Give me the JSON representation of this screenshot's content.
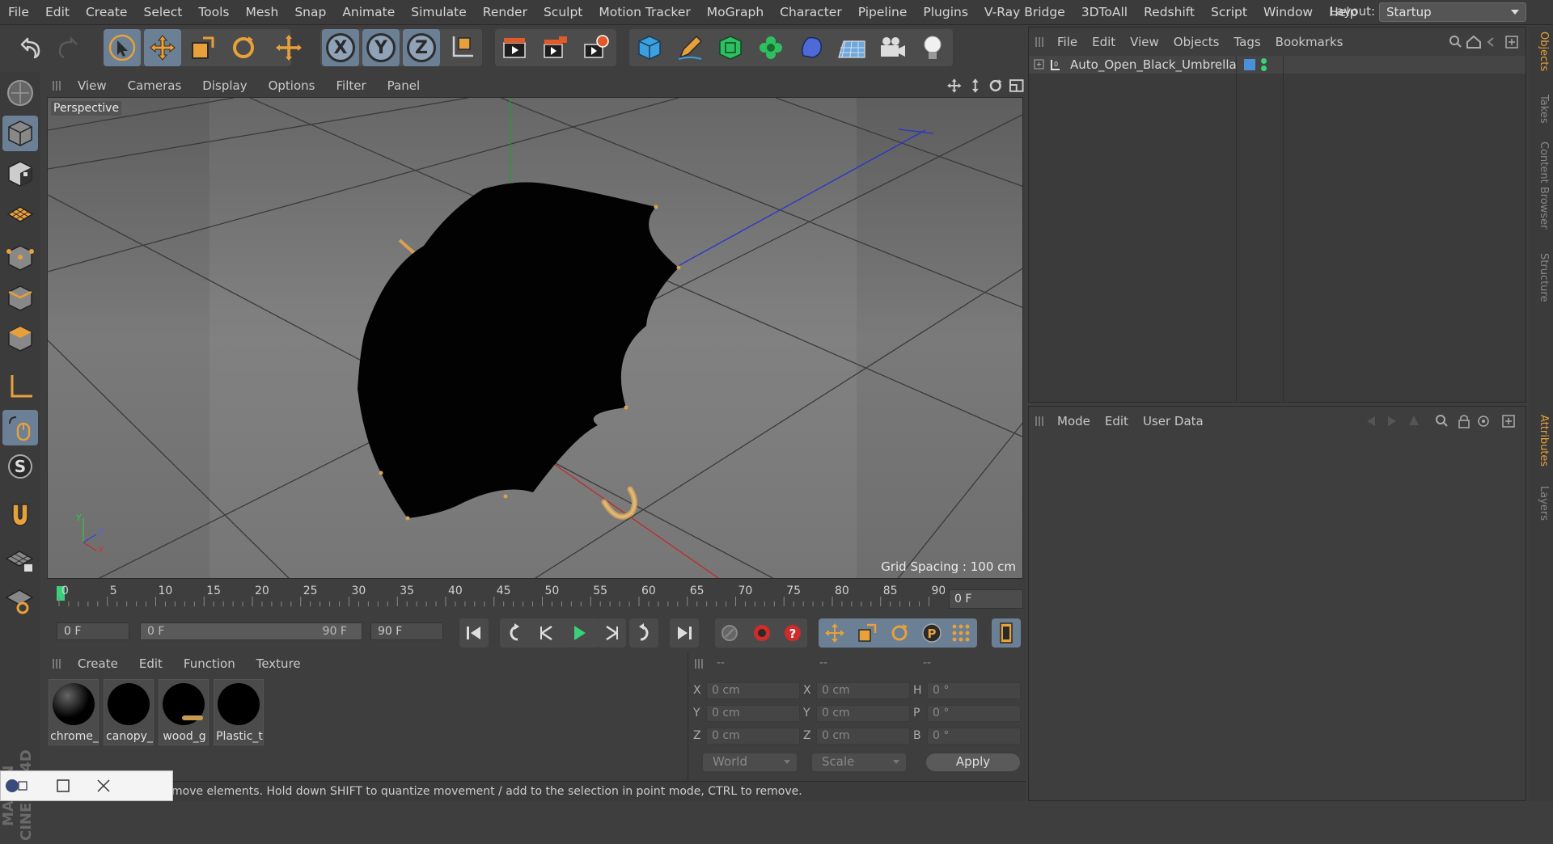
{
  "menubar": {
    "items": [
      "File",
      "Edit",
      "Create",
      "Select",
      "Tools",
      "Mesh",
      "Snap",
      "Animate",
      "Simulate",
      "Render",
      "Sculpt",
      "Motion Tracker",
      "MoGraph",
      "Character",
      "Pipeline",
      "Plugins",
      "V-Ray Bridge",
      "3DToAll",
      "Redshift",
      "Script",
      "Window",
      "Help"
    ],
    "layout_label": "Layout:",
    "layout_value": "Startup"
  },
  "viewport": {
    "menu": [
      "View",
      "Cameras",
      "Display",
      "Options",
      "Filter",
      "Panel"
    ],
    "label": "Perspective",
    "grid_spacing": "Grid Spacing : 100 cm",
    "axis_labels": {
      "y": "Y",
      "z": "Z",
      "x": "X"
    }
  },
  "timeline": {
    "ticks": [
      "0",
      "5",
      "10",
      "15",
      "20",
      "25",
      "30",
      "35",
      "40",
      "45",
      "50",
      "55",
      "60",
      "65",
      "70",
      "75",
      "80",
      "85",
      "90"
    ],
    "current_frame": "0 F",
    "start": "0 F",
    "range_start": "0 F",
    "range_end": "90 F",
    "end": "90 F"
  },
  "materials": {
    "menu": [
      "Create",
      "Edit",
      "Function",
      "Texture"
    ],
    "items": [
      "chrome_",
      "canopy_",
      "wood_g",
      "Plastic_t"
    ]
  },
  "coords": {
    "header": [
      "--",
      "--",
      "--"
    ],
    "rows": [
      {
        "a": "X",
        "av": "0 cm",
        "b": "X",
        "bv": "0 cm",
        "c": "H",
        "cv": "0 °"
      },
      {
        "a": "Y",
        "av": "0 cm",
        "b": "Y",
        "bv": "0 cm",
        "c": "P",
        "cv": "0 °"
      },
      {
        "a": "Z",
        "av": "0 cm",
        "b": "Z",
        "bv": "0 cm",
        "c": "B",
        "cv": "0 °"
      }
    ],
    "mode": "World",
    "transform": "Scale",
    "apply": "Apply"
  },
  "objects": {
    "menu": [
      "File",
      "Edit",
      "View",
      "Objects",
      "Tags",
      "Bookmarks"
    ],
    "items": [
      {
        "name": "Auto_Open_Black_Umbrella"
      }
    ]
  },
  "attributes": {
    "menu": [
      "Mode",
      "Edit",
      "User Data"
    ]
  },
  "sidetabs": [
    "Objects",
    "Takes",
    "Content Browser",
    "Structure",
    "Attributes",
    "Layers"
  ],
  "status": "move elements. Hold down SHIFT to quantize movement / add to the selection in point mode, CTRL to remove.",
  "brand": "MAXON CINEMA 4D",
  "colors": {
    "accent": "#e8a03a",
    "select_blue": "#6b7f95",
    "axis_x": "#c0392b",
    "axis_y": "#2ecc40",
    "axis_z": "#3344cc"
  }
}
